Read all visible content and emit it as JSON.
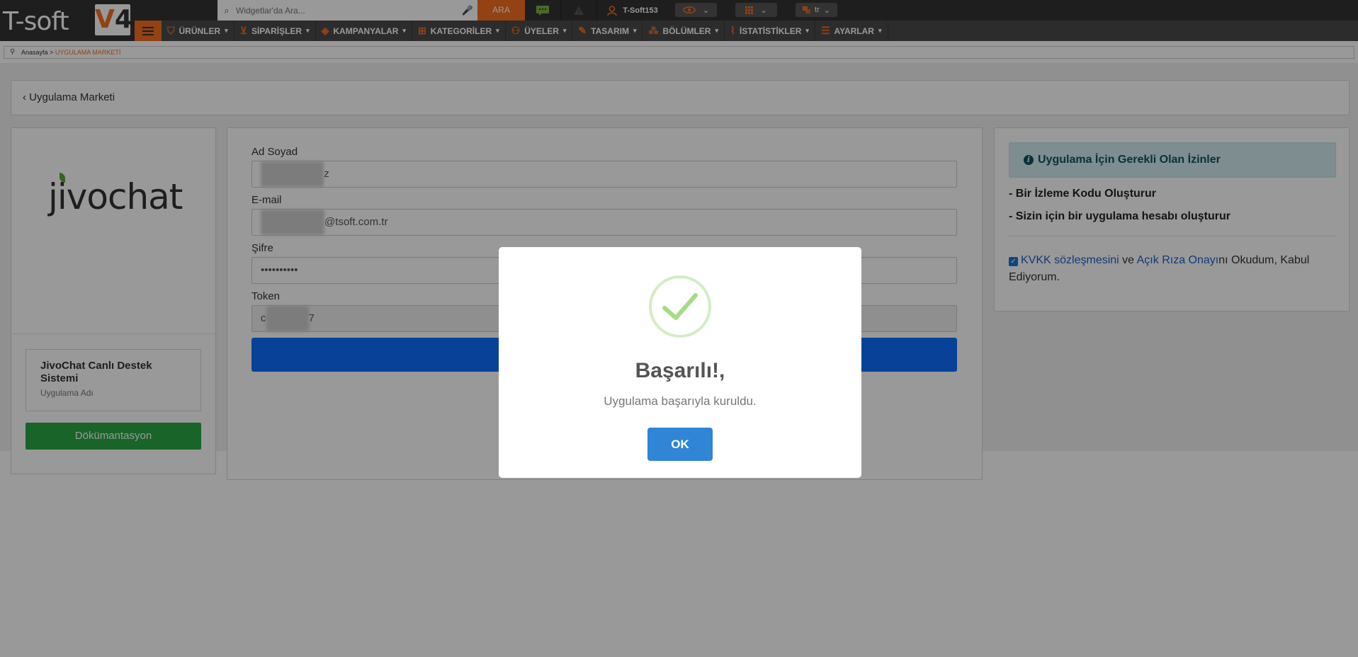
{
  "header": {
    "logo_text": "T-soft",
    "logo_v": "V",
    "logo_num": "4",
    "search_placeholder": "Widgetlar'da Ara...",
    "search_button": "ARA",
    "username": "T-Soft153",
    "language": "tr"
  },
  "nav": {
    "items": [
      {
        "label": "ÜRÜNLER",
        "icon": "shirt-icon"
      },
      {
        "label": "SİPARİŞLER",
        "icon": "cart-icon"
      },
      {
        "label": "KAMPANYALAR",
        "icon": "tag-icon"
      },
      {
        "label": "KATEGORİLER",
        "icon": "sitemap-icon"
      },
      {
        "label": "ÜYELER",
        "icon": "users-icon"
      },
      {
        "label": "TASARIM",
        "icon": "brush-icon"
      },
      {
        "label": "BÖLÜMLER",
        "icon": "sections-icon"
      },
      {
        "label": "İSTATİSTİKLER",
        "icon": "chart-icon"
      },
      {
        "label": "AYARLAR",
        "icon": "settings-icon"
      }
    ]
  },
  "breadcrumb": {
    "home": "Anasayfa",
    "separator": ">",
    "current": "UYGULAMA MARKETİ"
  },
  "page": {
    "title": "Uygulama Marketi"
  },
  "app": {
    "logo_text": "jivochat",
    "name": "JivoChat Canlı Destek Sistemi",
    "name_caption": "Uygulama Adı",
    "doc_button": "Dökümantasyon"
  },
  "form": {
    "name_label": "Ad Soyad",
    "name_suffix": "z",
    "email_label": "E-mail",
    "email_suffix": "@tsoft.com.tr",
    "password_label": "Şifre",
    "password_value": "••••••••••",
    "token_label": "Token",
    "token_prefix": "c",
    "token_suffix": "7"
  },
  "permissions": {
    "title": "Uygulama İçin Gerekli Olan İzinler",
    "items": [
      "- Bir İzleme Kodu Oluşturur",
      "- Sizin için bir uygulama hesabı oluşturur"
    ],
    "consent_link1": "KVKK sözleşmesini",
    "consent_mid": " ve ",
    "consent_link2": "Açık Rıza Onayı",
    "consent_end": "nı Okudum, Kabul Ediyorum.",
    "consent_checked": true
  },
  "modal": {
    "title": "Başarılı!,",
    "message": "Uygulama başarıyla kuruldu.",
    "ok_button": "OK"
  },
  "colors": {
    "brand_orange": "#f36f21",
    "topbar": "#333333",
    "primary_blue": "#0d6efd",
    "success_green": "#28a745",
    "modal_button": "#3085d6"
  }
}
